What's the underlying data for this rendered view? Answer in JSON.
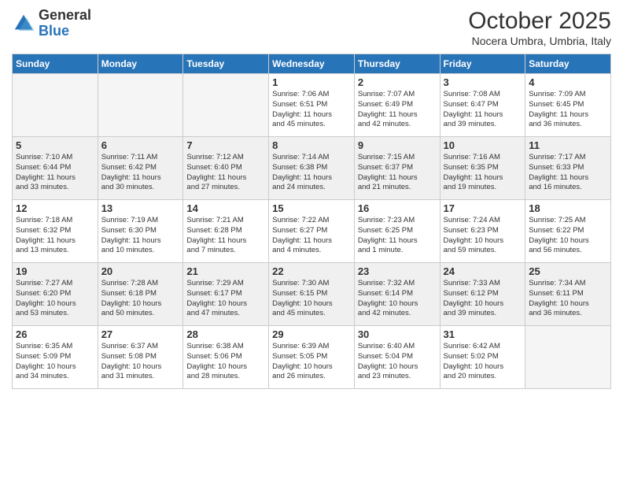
{
  "header": {
    "logo_general": "General",
    "logo_blue": "Blue",
    "month_title": "October 2025",
    "location": "Nocera Umbra, Umbria, Italy"
  },
  "weekdays": [
    "Sunday",
    "Monday",
    "Tuesday",
    "Wednesday",
    "Thursday",
    "Friday",
    "Saturday"
  ],
  "weeks": [
    [
      {
        "day": "",
        "text": "",
        "empty": true
      },
      {
        "day": "",
        "text": "",
        "empty": true
      },
      {
        "day": "",
        "text": "",
        "empty": true
      },
      {
        "day": "1",
        "text": "Sunrise: 7:06 AM\nSunset: 6:51 PM\nDaylight: 11 hours\nand 45 minutes."
      },
      {
        "day": "2",
        "text": "Sunrise: 7:07 AM\nSunset: 6:49 PM\nDaylight: 11 hours\nand 42 minutes."
      },
      {
        "day": "3",
        "text": "Sunrise: 7:08 AM\nSunset: 6:47 PM\nDaylight: 11 hours\nand 39 minutes."
      },
      {
        "day": "4",
        "text": "Sunrise: 7:09 AM\nSunset: 6:45 PM\nDaylight: 11 hours\nand 36 minutes."
      }
    ],
    [
      {
        "day": "5",
        "text": "Sunrise: 7:10 AM\nSunset: 6:44 PM\nDaylight: 11 hours\nand 33 minutes."
      },
      {
        "day": "6",
        "text": "Sunrise: 7:11 AM\nSunset: 6:42 PM\nDaylight: 11 hours\nand 30 minutes."
      },
      {
        "day": "7",
        "text": "Sunrise: 7:12 AM\nSunset: 6:40 PM\nDaylight: 11 hours\nand 27 minutes."
      },
      {
        "day": "8",
        "text": "Sunrise: 7:14 AM\nSunset: 6:38 PM\nDaylight: 11 hours\nand 24 minutes."
      },
      {
        "day": "9",
        "text": "Sunrise: 7:15 AM\nSunset: 6:37 PM\nDaylight: 11 hours\nand 21 minutes."
      },
      {
        "day": "10",
        "text": "Sunrise: 7:16 AM\nSunset: 6:35 PM\nDaylight: 11 hours\nand 19 minutes."
      },
      {
        "day": "11",
        "text": "Sunrise: 7:17 AM\nSunset: 6:33 PM\nDaylight: 11 hours\nand 16 minutes."
      }
    ],
    [
      {
        "day": "12",
        "text": "Sunrise: 7:18 AM\nSunset: 6:32 PM\nDaylight: 11 hours\nand 13 minutes."
      },
      {
        "day": "13",
        "text": "Sunrise: 7:19 AM\nSunset: 6:30 PM\nDaylight: 11 hours\nand 10 minutes."
      },
      {
        "day": "14",
        "text": "Sunrise: 7:21 AM\nSunset: 6:28 PM\nDaylight: 11 hours\nand 7 minutes."
      },
      {
        "day": "15",
        "text": "Sunrise: 7:22 AM\nSunset: 6:27 PM\nDaylight: 11 hours\nand 4 minutes."
      },
      {
        "day": "16",
        "text": "Sunrise: 7:23 AM\nSunset: 6:25 PM\nDaylight: 11 hours\nand 1 minute."
      },
      {
        "day": "17",
        "text": "Sunrise: 7:24 AM\nSunset: 6:23 PM\nDaylight: 10 hours\nand 59 minutes."
      },
      {
        "day": "18",
        "text": "Sunrise: 7:25 AM\nSunset: 6:22 PM\nDaylight: 10 hours\nand 56 minutes."
      }
    ],
    [
      {
        "day": "19",
        "text": "Sunrise: 7:27 AM\nSunset: 6:20 PM\nDaylight: 10 hours\nand 53 minutes."
      },
      {
        "day": "20",
        "text": "Sunrise: 7:28 AM\nSunset: 6:18 PM\nDaylight: 10 hours\nand 50 minutes."
      },
      {
        "day": "21",
        "text": "Sunrise: 7:29 AM\nSunset: 6:17 PM\nDaylight: 10 hours\nand 47 minutes."
      },
      {
        "day": "22",
        "text": "Sunrise: 7:30 AM\nSunset: 6:15 PM\nDaylight: 10 hours\nand 45 minutes."
      },
      {
        "day": "23",
        "text": "Sunrise: 7:32 AM\nSunset: 6:14 PM\nDaylight: 10 hours\nand 42 minutes."
      },
      {
        "day": "24",
        "text": "Sunrise: 7:33 AM\nSunset: 6:12 PM\nDaylight: 10 hours\nand 39 minutes."
      },
      {
        "day": "25",
        "text": "Sunrise: 7:34 AM\nSunset: 6:11 PM\nDaylight: 10 hours\nand 36 minutes."
      }
    ],
    [
      {
        "day": "26",
        "text": "Sunrise: 6:35 AM\nSunset: 5:09 PM\nDaylight: 10 hours\nand 34 minutes."
      },
      {
        "day": "27",
        "text": "Sunrise: 6:37 AM\nSunset: 5:08 PM\nDaylight: 10 hours\nand 31 minutes."
      },
      {
        "day": "28",
        "text": "Sunrise: 6:38 AM\nSunset: 5:06 PM\nDaylight: 10 hours\nand 28 minutes."
      },
      {
        "day": "29",
        "text": "Sunrise: 6:39 AM\nSunset: 5:05 PM\nDaylight: 10 hours\nand 26 minutes."
      },
      {
        "day": "30",
        "text": "Sunrise: 6:40 AM\nSunset: 5:04 PM\nDaylight: 10 hours\nand 23 minutes."
      },
      {
        "day": "31",
        "text": "Sunrise: 6:42 AM\nSunset: 5:02 PM\nDaylight: 10 hours\nand 20 minutes."
      },
      {
        "day": "",
        "text": "",
        "empty": true
      }
    ]
  ]
}
